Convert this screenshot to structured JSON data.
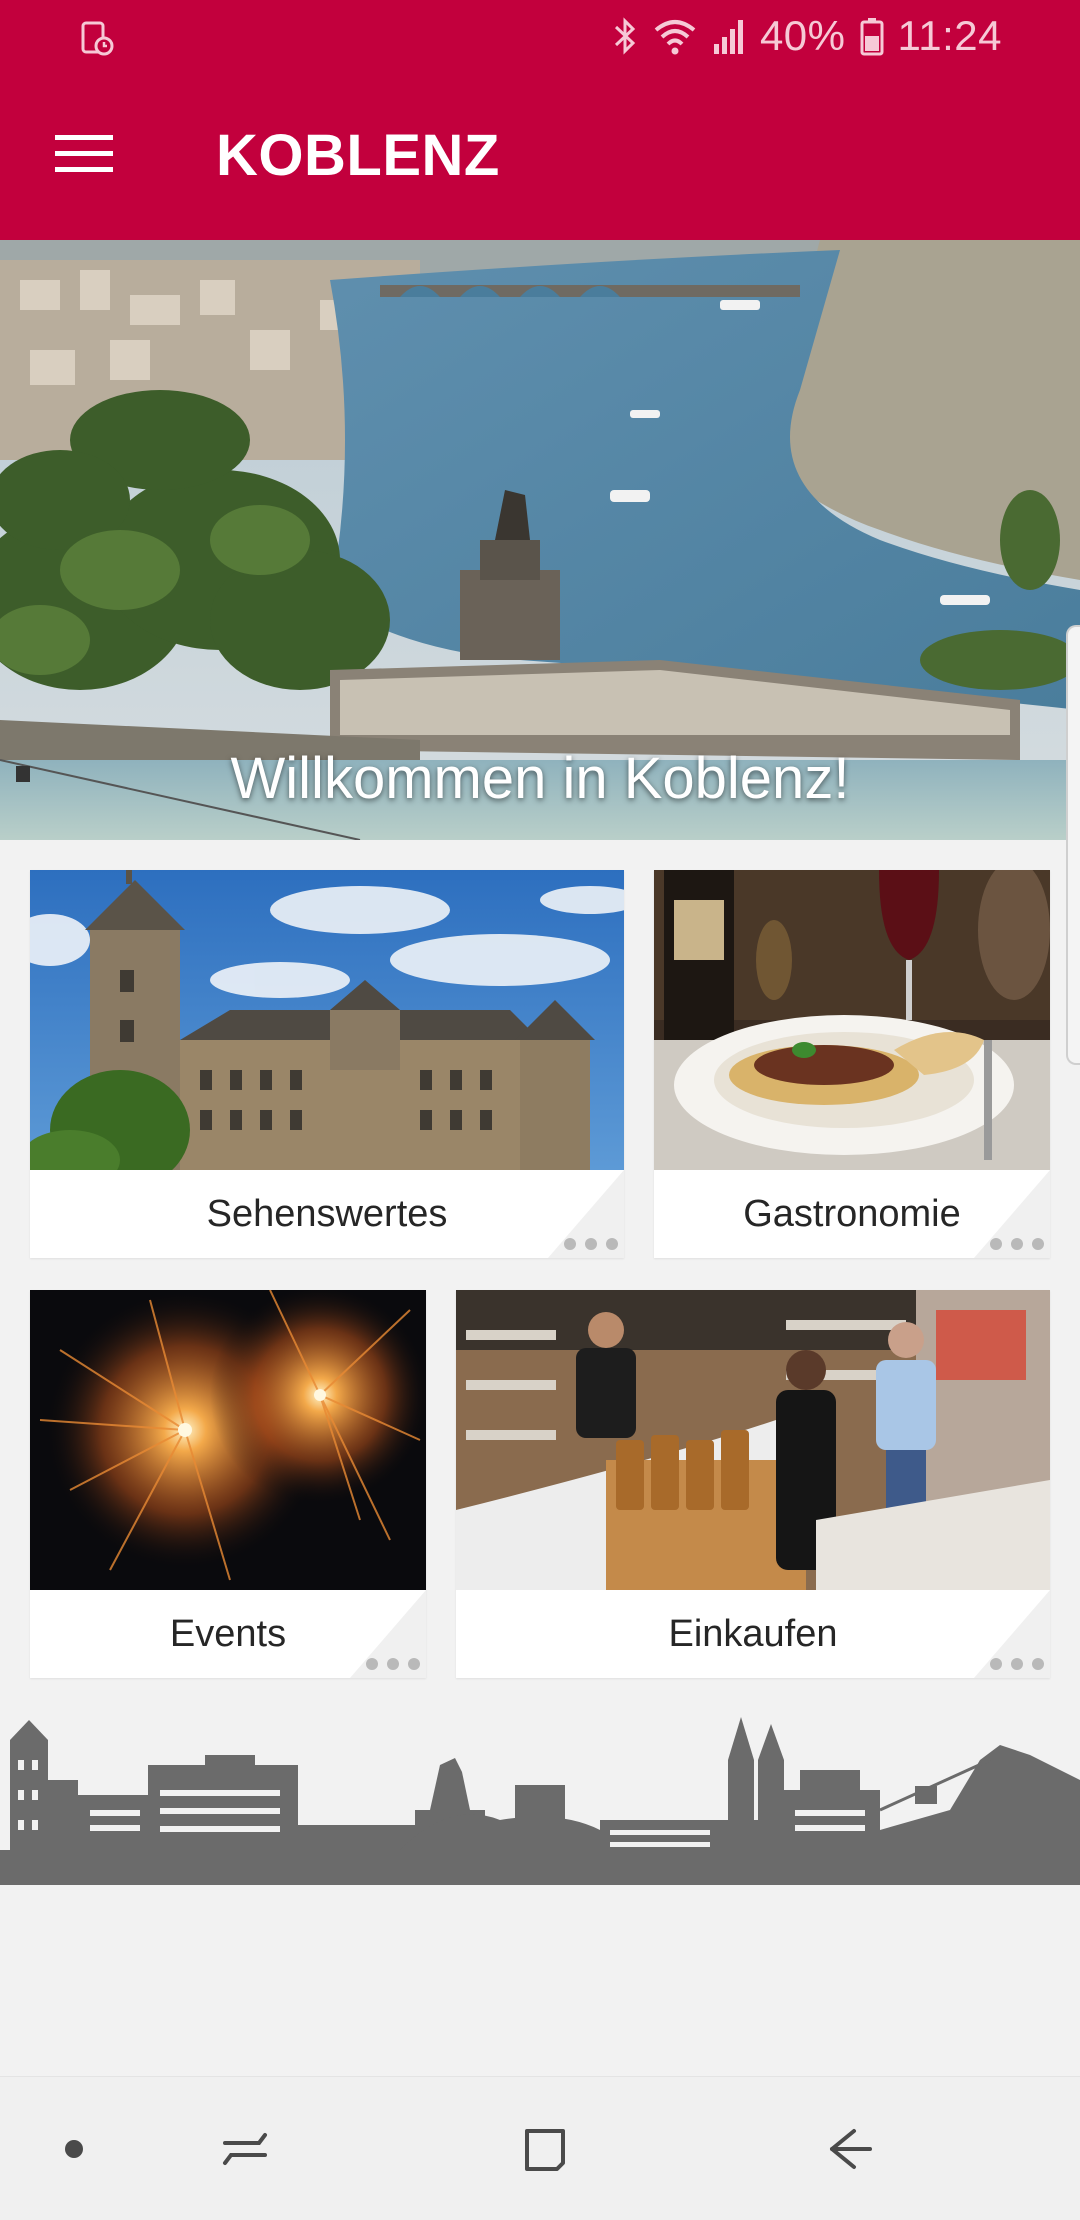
{
  "status_bar": {
    "battery_percent": "40%",
    "time": "11:24",
    "icons": [
      "screen-record-icon",
      "bluetooth-icon",
      "wifi-icon",
      "signal-icon",
      "battery-icon"
    ]
  },
  "app_bar": {
    "title": "KOBLENZ",
    "menu_icon": "hamburger-menu-icon",
    "background_color": "#c2003d"
  },
  "hero": {
    "caption": "Willkommen in Koblenz!",
    "image": "deutsches-eck-aerial-photo"
  },
  "tiles": [
    {
      "label": "Sehenswertes",
      "image": "castle-building-photo",
      "more_icon": "more-dots-icon"
    },
    {
      "label": "Gastronomie",
      "image": "pasta-dish-photo",
      "more_icon": "more-dots-icon"
    },
    {
      "label": "Events",
      "image": "fireworks-photo",
      "more_icon": "more-dots-icon"
    },
    {
      "label": "Einkaufen",
      "image": "bakery-shop-photo",
      "more_icon": "more-dots-icon"
    }
  ],
  "footer": {
    "image": "koblenz-skyline-silhouette"
  },
  "nav_bar": {
    "buttons": [
      "home-dot-icon",
      "recent-apps-icon",
      "overview-square-icon",
      "back-arrow-icon"
    ]
  }
}
